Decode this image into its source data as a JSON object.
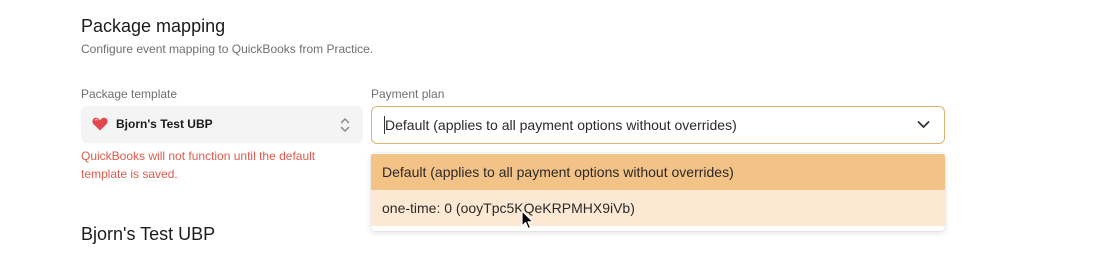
{
  "section": {
    "title": "Package mapping",
    "subtitle": "Configure event mapping to QuickBooks from Practice."
  },
  "package_template": {
    "label": "Package template",
    "value": "Bjorn's Test UBP",
    "icon": "heart-icon",
    "error": "QuickBooks will not function until the default template is saved."
  },
  "payment_plan": {
    "label": "Payment plan",
    "value": "Default (applies to all payment options without overrides)",
    "options": [
      "Default (applies to all payment options without overrides)",
      "one-time: 0 (ooyTpc5KQeKRPMHX9iVb)"
    ]
  },
  "subsection": {
    "title": "Bjorn's Test UBP"
  },
  "colors": {
    "accent_border": "#d9b571",
    "selected_option": "#f3c286",
    "hovered_option": "#fde9d3",
    "error": "#e05b4c",
    "heart": "#e2474f"
  }
}
